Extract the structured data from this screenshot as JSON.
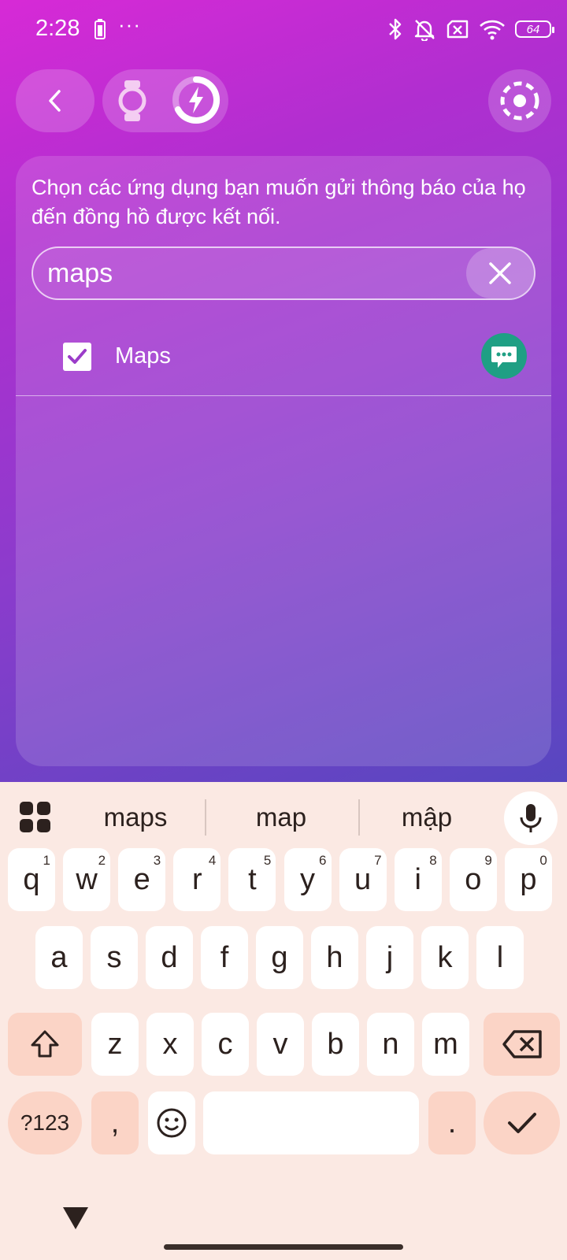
{
  "status_bar": {
    "time": "2:28",
    "dots": "···",
    "battery_level": "64"
  },
  "header": {
    "back_icon": "chevron-left-icon",
    "watch_icon": "watch-icon",
    "charge_icon": "lightning-icon",
    "settings_icon": "dashed-circle-icon"
  },
  "card": {
    "description": "Chọn các ứng dụng bạn muốn gửi thông báo của họ đến đồng hồ được kết nối.",
    "search": {
      "value": "maps",
      "clear_icon": "close-icon"
    },
    "apps": [
      {
        "label": "Maps",
        "checked": true,
        "icon": "chat-bubble-icon"
      }
    ]
  },
  "keyboard": {
    "suggestions": [
      "maps",
      "map",
      "mập"
    ],
    "row1": [
      {
        "k": "q",
        "h": "1"
      },
      {
        "k": "w",
        "h": "2"
      },
      {
        "k": "e",
        "h": "3"
      },
      {
        "k": "r",
        "h": "4"
      },
      {
        "k": "t",
        "h": "5"
      },
      {
        "k": "y",
        "h": "6"
      },
      {
        "k": "u",
        "h": "7"
      },
      {
        "k": "i",
        "h": "8"
      },
      {
        "k": "o",
        "h": "9"
      },
      {
        "k": "p",
        "h": "0"
      }
    ],
    "row2": [
      "a",
      "s",
      "d",
      "f",
      "g",
      "h",
      "j",
      "k",
      "l"
    ],
    "row3": [
      "z",
      "x",
      "c",
      "v",
      "b",
      "n",
      "m"
    ],
    "symbols_label": "?123",
    "comma_label": ",",
    "period_label": ".",
    "accent_color": "#fbd4c6"
  }
}
